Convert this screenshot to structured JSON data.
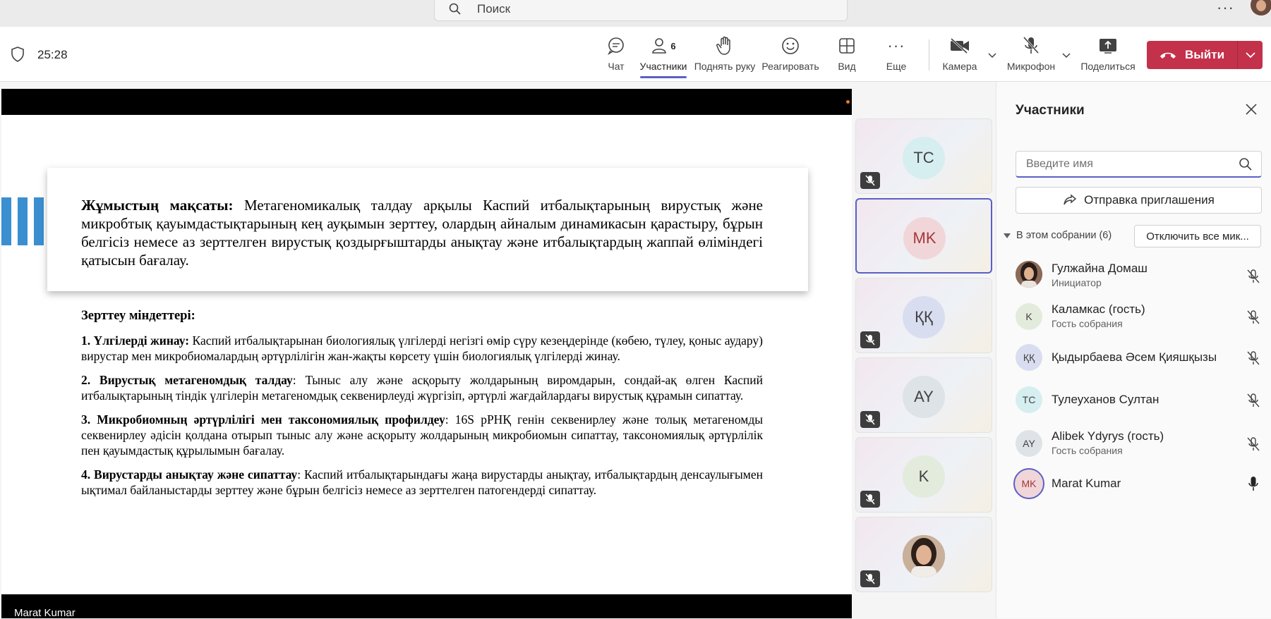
{
  "titlebar": {
    "search_placeholder": "Поиск",
    "more_icon": "more-horizontal-icon",
    "avatar_icon": "user-avatar"
  },
  "toolbar": {
    "timer": "25:28",
    "chat_label": "Чат",
    "participants_label": "Участники",
    "participants_count": "6",
    "raise_hand_label": "Поднять руку",
    "react_label": "Реагировать",
    "view_label": "Вид",
    "more_label": "Еще",
    "camera_label": "Камера",
    "mic_label": "Микрофон",
    "share_label": "Поделиться",
    "leave_label": "Выйти",
    "accent_color": "#5b5fc7",
    "leave_color": "#c4314b"
  },
  "slide": {
    "goal_title": "Жұмыстың мақсаты:",
    "goal_body": " Метагеномикалық талдау арқылы Каспий итбалықтарының вирустық және микробтық қауымдастықтарының кең ауқымын зерттеу, олардың айналым динамикасын қарастыру, бұрын белгісіз немесе аз зерттелген вирустық қоздырғыштарды анықтау және итбалықтардың жаппай өліміндегі қатысын бағалау.",
    "tasks_heading": "Зерттеу міндеттері:",
    "tasks": [
      {
        "title": "1. Үлгілерді жинау:",
        "body": " Каспий итбалықтарынан биологиялық үлгілерді негізгі өмір сүру кезеңдерінде (көбею, түлеу, қоныс аудару) вирустар мен микробиомалардың әртүрлілігін жан-жақты көрсету үшін биологиялық үлгілерді жинау."
      },
      {
        "title": "2. Вирустық метагеномдық талдау",
        "body": ": Тыныс алу және асқорыту жолдарының виромдарын, сондай-ақ өлген Каспий итбалықтарының тіндік үлгілерін метагеномдық секвенирлеуді жүргізіп, әртүрлі жағдайлардағы вирустық құрамын сипаттау."
      },
      {
        "title": "3. Микробиомның әртүрлілігі мен таксономиялық профилдеу",
        "body": ": 16S рРНҚ генін секвенирлеу және толық метагеномды секвенирлеу әдісін қолдана отырып тыныс алу және асқорыту жолдарының микробиомын сипаттау, таксономиялық әртүрлілік пен қауымдастық құрылымын бағалау."
      },
      {
        "title": "4. Вирустарды анықтау және сипаттау",
        "body": ": Каспий итбалықтарындағы жаңа вирустарды анықтау, итбалықтардың денсаулығымен ықтимал байланыстарды зерттеу және бұрын белгісіз немесе аз зерттелген патогендерді сипаттау."
      }
    ],
    "presenter": "Marat Kumar",
    "accent_color": "#3a8fd1"
  },
  "tiles": [
    {
      "initials": "TC",
      "bg": "#d6eef0",
      "muted": true,
      "active": false
    },
    {
      "initials": "MK",
      "bg": "#f1d6d9",
      "muted": false,
      "active": true
    },
    {
      "initials": "ҚҚ",
      "bg": "#d9ddf0",
      "muted": true,
      "active": false
    },
    {
      "initials": "AY",
      "bg": "#dde3e6",
      "muted": true,
      "active": false
    },
    {
      "initials": "K",
      "bg": "#e3ebdd",
      "muted": true,
      "active": false
    },
    {
      "initials": "",
      "bg": "#b99379",
      "muted": true,
      "active": false,
      "photo": true
    }
  ],
  "panel": {
    "title": "Участники",
    "search_placeholder": "Введите имя",
    "invite_label": "Отправка приглашения",
    "section_label": "В этом собрании (6)",
    "mute_all_label": "Отключить все мик...",
    "participants": [
      {
        "name": "Гулжайна Домаш",
        "role": "Инициатор",
        "initials": "",
        "avatar_bg": "#7a5a4a",
        "photo": true,
        "mic": "muted"
      },
      {
        "name": "Каламкас (гость)",
        "role": "Гость собрания",
        "initials": "K",
        "avatar_bg": "#e3ebdd",
        "mic": "muted"
      },
      {
        "name": "Қыдырбаева Әсем Қияшқызы",
        "role": "",
        "initials": "ҚҚ",
        "avatar_bg": "#d9ddf0",
        "mic": "muted"
      },
      {
        "name": "Тулеуханов Султан",
        "role": "",
        "initials": "TC",
        "avatar_bg": "#d6eef0",
        "mic": "muted"
      },
      {
        "name": "Alibek Ydyrys (гость)",
        "role": "Гость собрания",
        "initials": "AY",
        "avatar_bg": "#dde3e6",
        "mic": "muted"
      },
      {
        "name": "Marat Kumar",
        "role": "",
        "initials": "MK",
        "avatar_bg": "#f1d6d9",
        "mic": "on"
      }
    ]
  }
}
